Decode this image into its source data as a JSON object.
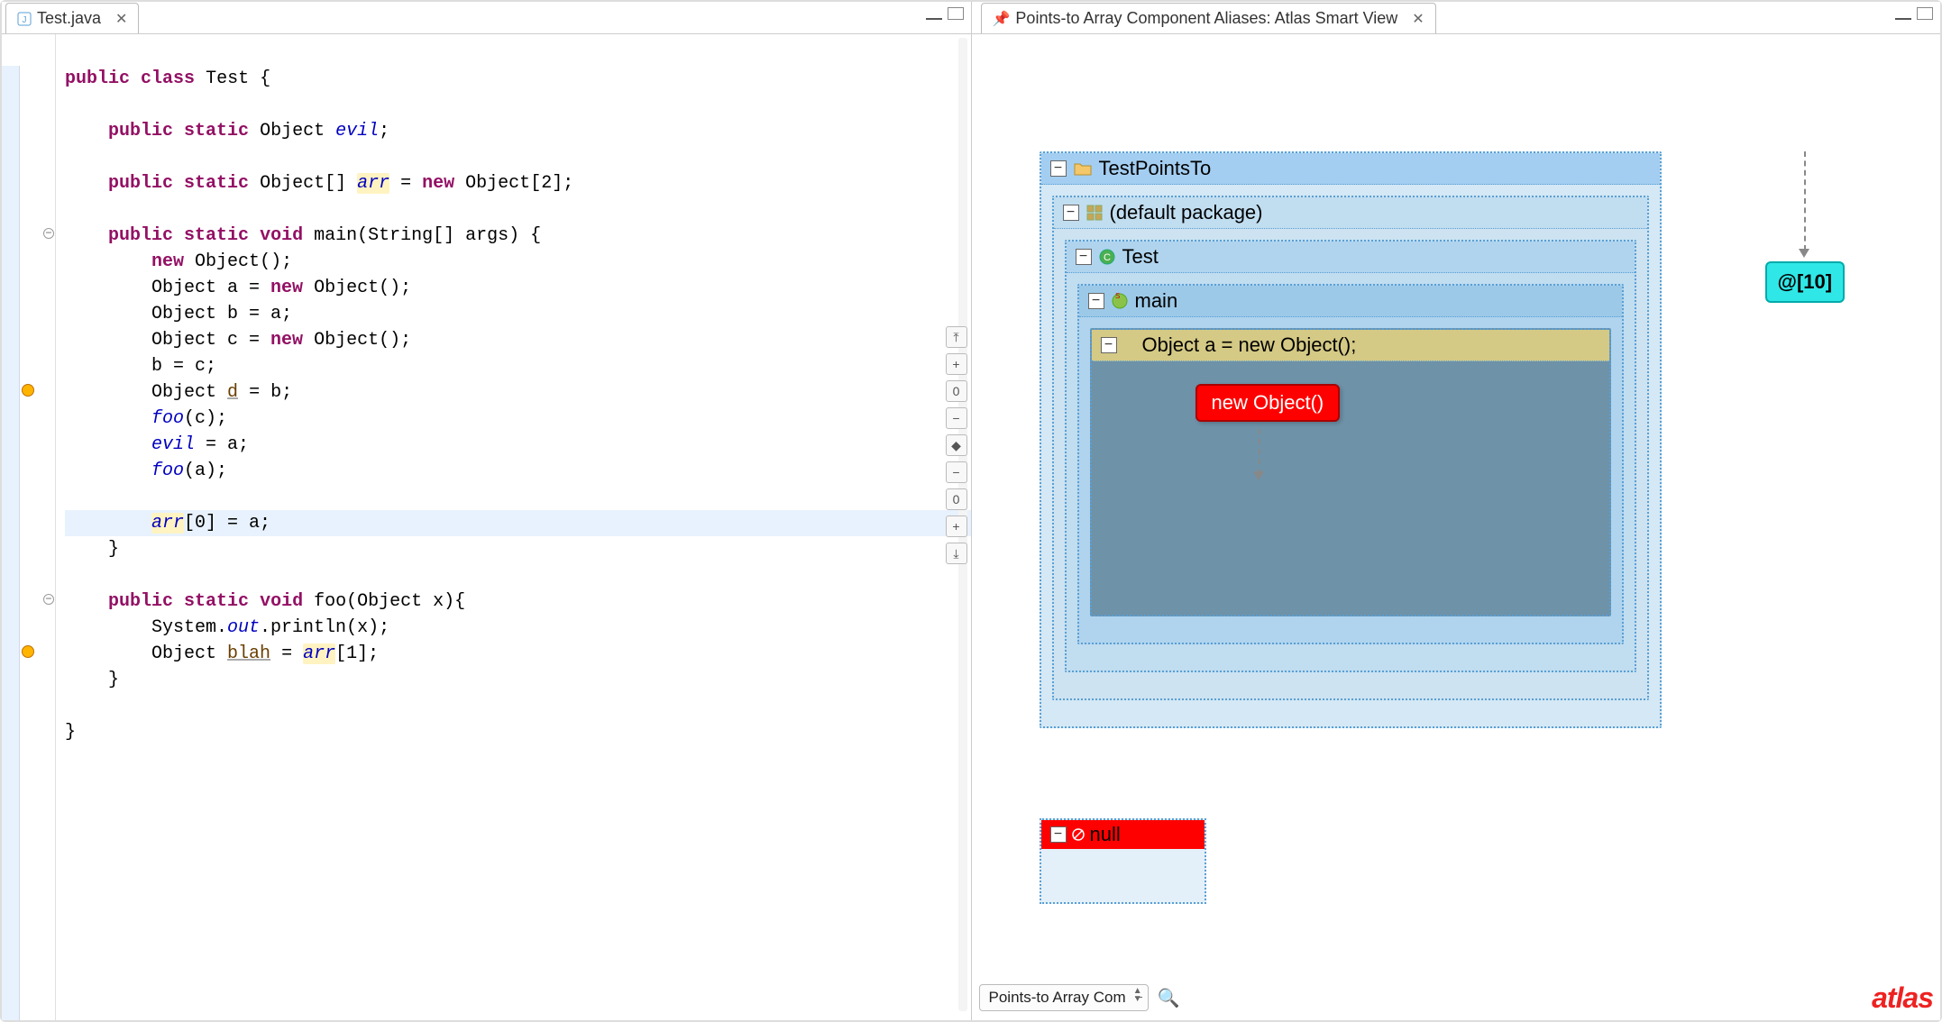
{
  "editor": {
    "tab_title": "Test.java",
    "code_lines": [
      {
        "tokens": [
          {
            "t": "kw",
            "v": "public"
          },
          {
            "t": "sp",
            "v": " "
          },
          {
            "t": "kw",
            "v": "class"
          },
          {
            "t": "sp",
            "v": " "
          },
          {
            "t": "type",
            "v": "Test"
          },
          {
            "t": "sp",
            "v": " {"
          }
        ]
      },
      {
        "tokens": []
      },
      {
        "tokens": [
          {
            "t": "sp",
            "v": "    "
          },
          {
            "t": "kw",
            "v": "public"
          },
          {
            "t": "sp",
            "v": " "
          },
          {
            "t": "kw",
            "v": "static"
          },
          {
            "t": "sp",
            "v": " "
          },
          {
            "t": "type",
            "v": "Object"
          },
          {
            "t": "sp",
            "v": " "
          },
          {
            "t": "fld",
            "v": "evil"
          },
          {
            "t": "sp",
            "v": ";"
          }
        ]
      },
      {
        "tokens": []
      },
      {
        "tokens": [
          {
            "t": "sp",
            "v": "    "
          },
          {
            "t": "kw",
            "v": "public"
          },
          {
            "t": "sp",
            "v": " "
          },
          {
            "t": "kw",
            "v": "static"
          },
          {
            "t": "sp",
            "v": " "
          },
          {
            "t": "type",
            "v": "Object[]"
          },
          {
            "t": "sp",
            "v": " "
          },
          {
            "t": "fld hl",
            "v": "arr"
          },
          {
            "t": "sp",
            "v": " = "
          },
          {
            "t": "kw",
            "v": "new"
          },
          {
            "t": "sp",
            "v": " "
          },
          {
            "t": "type",
            "v": "Object"
          },
          {
            "t": "sp",
            "v": "[2];"
          }
        ]
      },
      {
        "tokens": []
      },
      {
        "tokens": [
          {
            "t": "sp",
            "v": "    "
          },
          {
            "t": "kw",
            "v": "public"
          },
          {
            "t": "sp",
            "v": " "
          },
          {
            "t": "kw",
            "v": "static"
          },
          {
            "t": "sp",
            "v": " "
          },
          {
            "t": "kw",
            "v": "void"
          },
          {
            "t": "sp",
            "v": " "
          },
          {
            "t": "type",
            "v": "main"
          },
          {
            "t": "sp",
            "v": "(String[] args) {"
          }
        ]
      },
      {
        "tokens": [
          {
            "t": "sp",
            "v": "        "
          },
          {
            "t": "kw",
            "v": "new"
          },
          {
            "t": "sp",
            "v": " "
          },
          {
            "t": "type",
            "v": "Object"
          },
          {
            "t": "sp",
            "v": "();"
          }
        ]
      },
      {
        "tokens": [
          {
            "t": "sp",
            "v": "        "
          },
          {
            "t": "type",
            "v": "Object"
          },
          {
            "t": "sp",
            "v": " a = "
          },
          {
            "t": "kw",
            "v": "new"
          },
          {
            "t": "sp",
            "v": " "
          },
          {
            "t": "type",
            "v": "Object"
          },
          {
            "t": "sp",
            "v": "();"
          }
        ]
      },
      {
        "tokens": [
          {
            "t": "sp",
            "v": "        "
          },
          {
            "t": "type",
            "v": "Object"
          },
          {
            "t": "sp",
            "v": " b = a;"
          }
        ]
      },
      {
        "tokens": [
          {
            "t": "sp",
            "v": "        "
          },
          {
            "t": "type",
            "v": "Object"
          },
          {
            "t": "sp",
            "v": " c = "
          },
          {
            "t": "kw",
            "v": "new"
          },
          {
            "t": "sp",
            "v": " "
          },
          {
            "t": "type",
            "v": "Object"
          },
          {
            "t": "sp",
            "v": "();"
          }
        ]
      },
      {
        "tokens": [
          {
            "t": "sp",
            "v": "        b = c;"
          }
        ]
      },
      {
        "tokens": [
          {
            "t": "sp",
            "v": "        "
          },
          {
            "t": "type",
            "v": "Object"
          },
          {
            "t": "sp",
            "v": " "
          },
          {
            "t": "ul",
            "v": "d"
          },
          {
            "t": "sp",
            "v": " = b;"
          }
        ]
      },
      {
        "tokens": [
          {
            "t": "sp",
            "v": "        "
          },
          {
            "t": "fld",
            "v": "foo"
          },
          {
            "t": "sp",
            "v": "(c);"
          }
        ]
      },
      {
        "tokens": [
          {
            "t": "sp",
            "v": "        "
          },
          {
            "t": "fld",
            "v": "evil"
          },
          {
            "t": "sp",
            "v": " = a;"
          }
        ]
      },
      {
        "tokens": [
          {
            "t": "sp",
            "v": "        "
          },
          {
            "t": "fld",
            "v": "foo"
          },
          {
            "t": "sp",
            "v": "(a);"
          }
        ]
      },
      {
        "tokens": []
      },
      {
        "hl": true,
        "tokens": [
          {
            "t": "sp",
            "v": "        "
          },
          {
            "t": "fld hl",
            "v": "arr"
          },
          {
            "t": "sp",
            "v": "[0] = a;"
          }
        ]
      },
      {
        "tokens": [
          {
            "t": "sp",
            "v": "    }"
          }
        ]
      },
      {
        "tokens": []
      },
      {
        "tokens": [
          {
            "t": "sp",
            "v": "    "
          },
          {
            "t": "kw",
            "v": "public"
          },
          {
            "t": "sp",
            "v": " "
          },
          {
            "t": "kw",
            "v": "static"
          },
          {
            "t": "sp",
            "v": " "
          },
          {
            "t": "kw",
            "v": "void"
          },
          {
            "t": "sp",
            "v": " "
          },
          {
            "t": "type",
            "v": "foo"
          },
          {
            "t": "sp",
            "v": "(Object x){"
          }
        ]
      },
      {
        "tokens": [
          {
            "t": "sp",
            "v": "        System."
          },
          {
            "t": "fld",
            "v": "out"
          },
          {
            "t": "sp",
            "v": ".println(x);"
          }
        ]
      },
      {
        "tokens": [
          {
            "t": "sp",
            "v": "        "
          },
          {
            "t": "type",
            "v": "Object"
          },
          {
            "t": "sp",
            "v": " "
          },
          {
            "t": "ul",
            "v": "blah"
          },
          {
            "t": "sp",
            "v": " = "
          },
          {
            "t": "fld hl",
            "v": "arr"
          },
          {
            "t": "sp",
            "v": "[1];"
          }
        ]
      },
      {
        "tokens": [
          {
            "t": "sp",
            "v": "    }"
          }
        ]
      },
      {
        "tokens": []
      },
      {
        "tokens": [
          {
            "t": "sp",
            "v": "}"
          }
        ]
      }
    ],
    "gutter_markers": [
      {
        "line": 6,
        "type": "fold"
      },
      {
        "line": 12,
        "type": "warn"
      },
      {
        "line": 20,
        "type": "fold"
      },
      {
        "line": 22,
        "type": "warn"
      }
    ],
    "side_buttons": [
      "⤒",
      "+",
      "0",
      "−",
      "◆",
      "−",
      "0",
      "+",
      "⤓"
    ]
  },
  "smartview": {
    "tab_title": "Points-to Array Component Aliases: Atlas Smart View",
    "toolbar_icons": [
      "hierarchy-icon",
      "layout-icon",
      "fit-icon",
      "zoom-out-icon",
      "zoom-in-icon",
      "zoom-reset-icon",
      "pin-icon",
      "export-icon",
      "sync-icon"
    ],
    "graph": {
      "project": "TestPointsTo",
      "package": "(default package)",
      "class": "Test",
      "method": "main",
      "statement": "Object a = new Object();",
      "instantiation": "new Object()",
      "null_label": "null",
      "array_label": "@[10]"
    },
    "selector": "Points-to Array Com",
    "brand": "atlas"
  }
}
